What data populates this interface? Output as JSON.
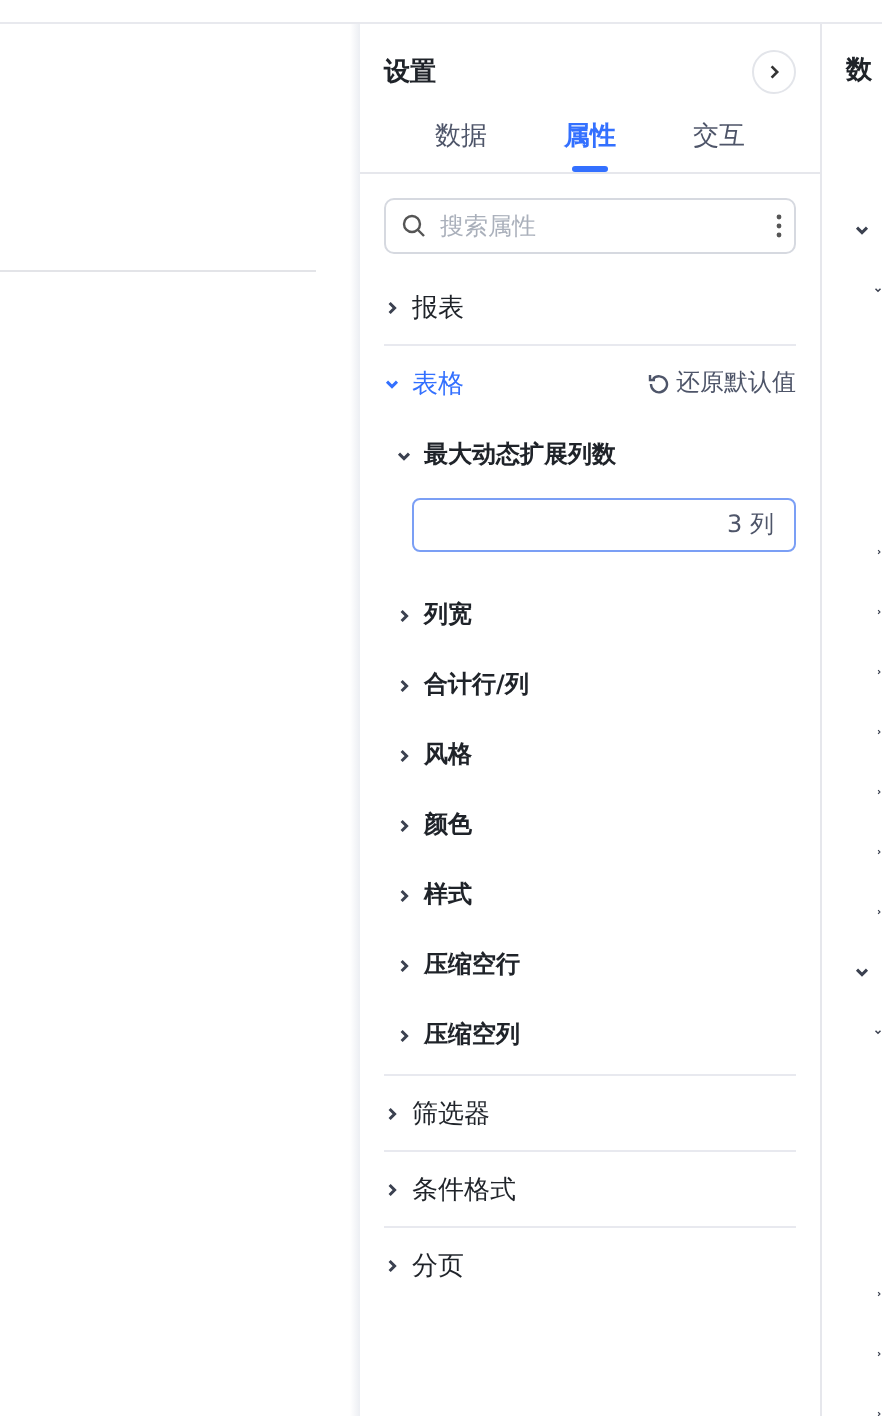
{
  "settings_panel": {
    "title": "设置",
    "tabs": [
      {
        "label": "数据",
        "selected": false
      },
      {
        "label": "属性",
        "selected": true
      },
      {
        "label": "交互",
        "selected": false
      }
    ],
    "search": {
      "placeholder": "搜索属性"
    },
    "sections": [
      {
        "label": "报表",
        "expanded": false
      },
      {
        "label": "表格",
        "expanded": true,
        "action": "还原默认值",
        "children": [
          {
            "label": "最大动态扩展列数",
            "expanded": true,
            "value": "3 列"
          },
          {
            "label": "列宽",
            "expanded": false
          },
          {
            "label": "合计行/列",
            "expanded": false
          },
          {
            "label": "风格",
            "expanded": false
          },
          {
            "label": "颜色",
            "expanded": false
          },
          {
            "label": "样式",
            "expanded": false
          },
          {
            "label": "压缩空行",
            "expanded": false
          },
          {
            "label": "压缩空列",
            "expanded": false
          }
        ]
      },
      {
        "label": "筛选器",
        "expanded": false
      },
      {
        "label": "条件格式",
        "expanded": false
      },
      {
        "label": "分页",
        "expanded": false
      }
    ]
  },
  "data_panel": {
    "title": "数",
    "tree": [
      {
        "expanded": true,
        "children": [
          {
            "expanded": true
          },
          {
            "expanded": false
          },
          {
            "expanded": false
          },
          {
            "expanded": false
          },
          {
            "expanded": false
          },
          {
            "expanded": false
          },
          {
            "expanded": false
          },
          {
            "expanded": false
          }
        ]
      },
      {
        "expanded": true,
        "children": [
          {
            "expanded": true
          },
          {
            "expanded": false
          },
          {
            "expanded": false
          },
          {
            "expanded": false
          }
        ]
      }
    ]
  }
}
